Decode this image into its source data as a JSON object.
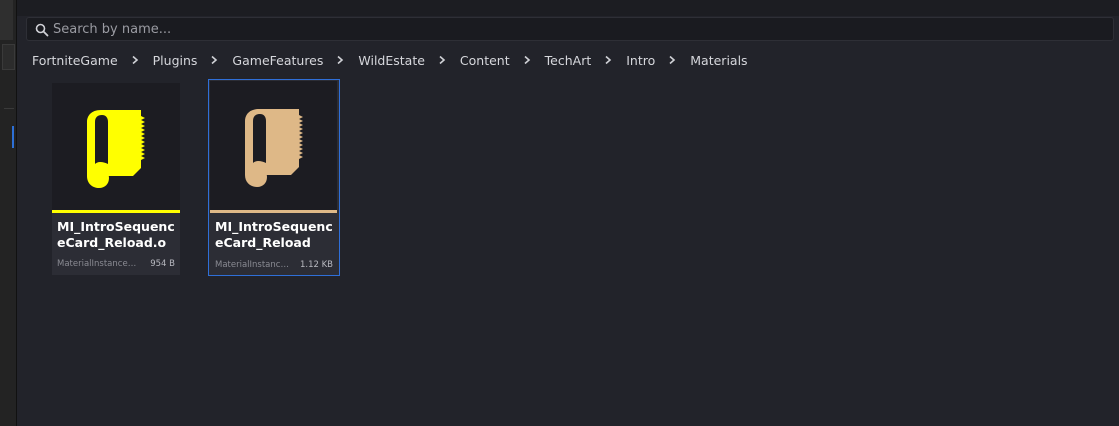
{
  "search": {
    "placeholder": "Search by name..."
  },
  "breadcrumb": [
    "FortniteGame",
    "Plugins",
    "GameFeatures",
    "WildEstate",
    "Content",
    "TechArt",
    "Intro",
    "Materials"
  ],
  "assets": [
    {
      "name": "MI_IntroSequenceCard_Reload.o",
      "type": "MaterialInstanceEdit...",
      "size": "954 B",
      "icon": "material-scroll-icon",
      "icon_color": "#ffff00",
      "bar_color": "#ffff00",
      "selected": false
    },
    {
      "name": "MI_IntroSequenceCard_Reload",
      "type": "MaterialInstanceCo...",
      "size": "1.12 KB",
      "icon": "material-scroll-icon",
      "icon_color": "#deb887",
      "bar_color": "#deb887",
      "selected": true
    }
  ],
  "colors": {
    "selection": "#2f6fd8",
    "background": "#22232a"
  }
}
